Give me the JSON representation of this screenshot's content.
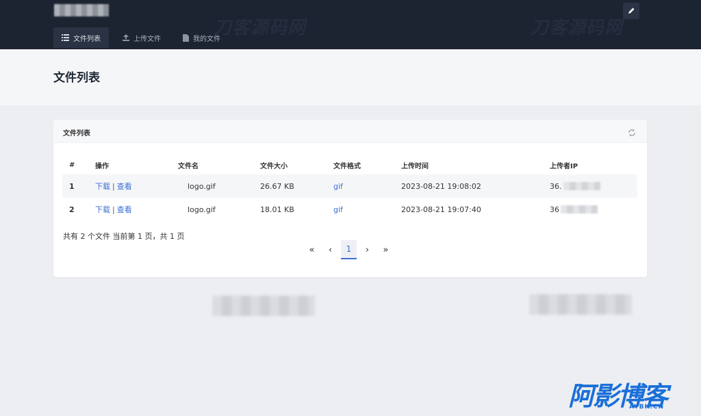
{
  "watermark_top": "刀客源码网",
  "nav": {
    "items": [
      {
        "label": "文件列表",
        "icon": "list-icon",
        "active": true
      },
      {
        "label": "上传文件",
        "icon": "upload-icon",
        "active": false
      },
      {
        "label": "我的文件",
        "icon": "file-icon",
        "active": false
      }
    ]
  },
  "page": {
    "title": "文件列表"
  },
  "card": {
    "title": "文件列表"
  },
  "table": {
    "headers": [
      "#",
      "操作",
      "文件名",
      "文件大小",
      "文件格式",
      "上传时间",
      "上传者IP"
    ],
    "rows": [
      {
        "idx": "1",
        "download": "下载",
        "sep": "|",
        "view": "查看",
        "name": "logo.gif",
        "size": "26.67 KB",
        "format": "gif",
        "time": "2023-08-21 19:08:02",
        "ip": "36."
      },
      {
        "idx": "2",
        "download": "下载",
        "sep": "|",
        "view": "查看",
        "name": "logo.gif",
        "size": "18.01 KB",
        "format": "gif",
        "time": "2023-08-21 19:07:40",
        "ip": "36"
      }
    ]
  },
  "summary": "共有 2 个文件  当前第 1 页，共 1 页",
  "pager": {
    "first": "«",
    "prev": "‹",
    "current": "1",
    "next": "›",
    "last": "»"
  },
  "watermark_bottom": {
    "big": "阿影博客",
    "small": "AYBK.CN"
  },
  "colors": {
    "topbar": "#1c2331",
    "accent": "#3b6fd6",
    "brand": "#1a6fd8"
  }
}
